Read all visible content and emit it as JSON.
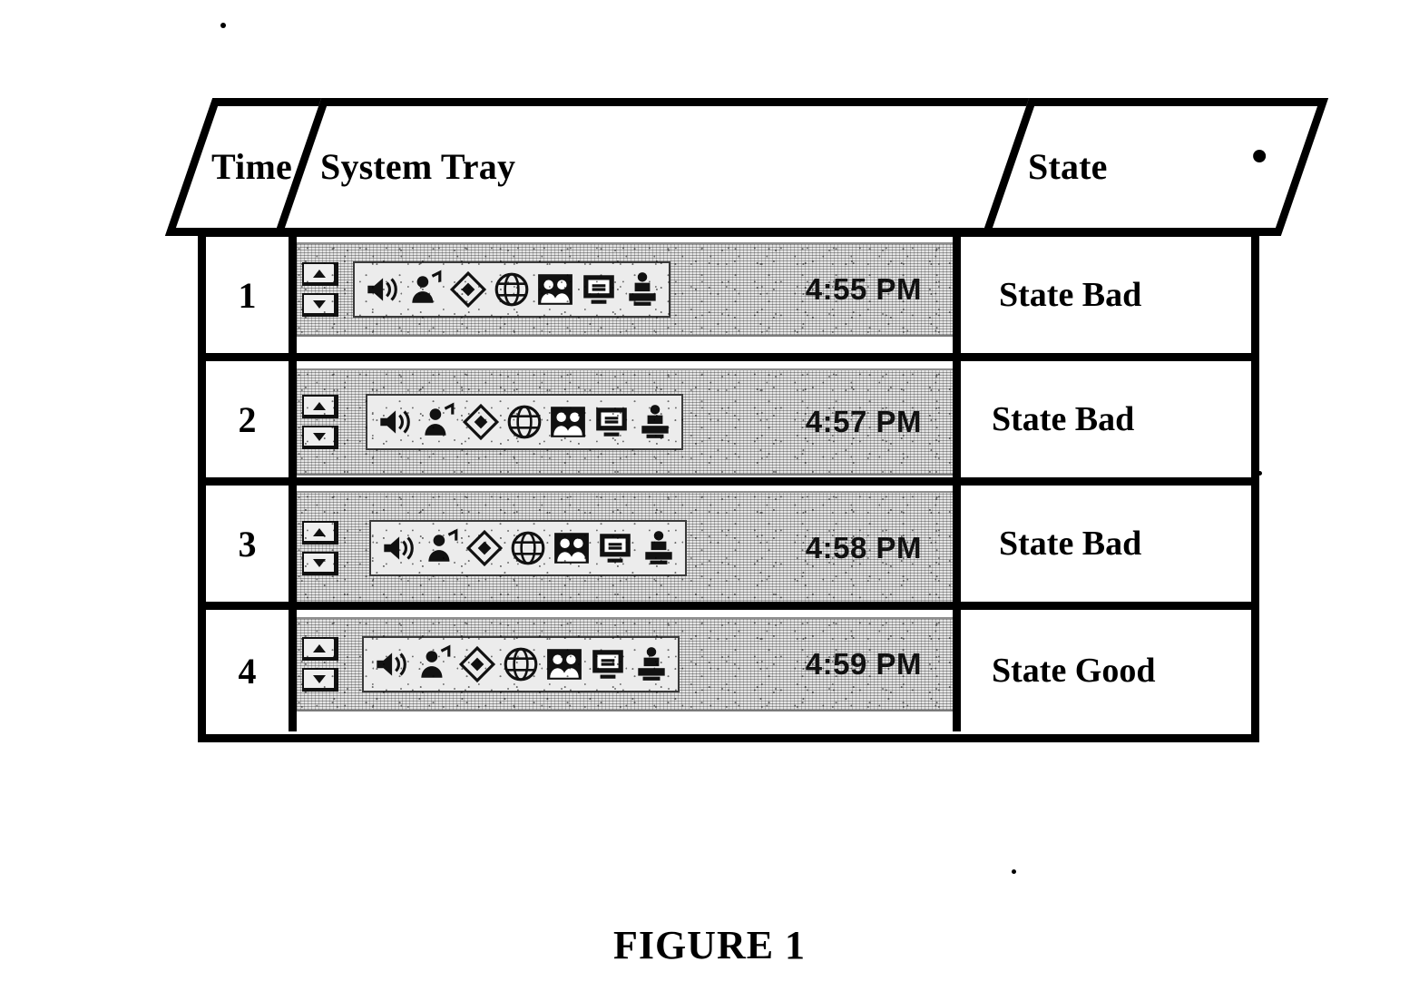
{
  "figure": {
    "caption": "FIGURE 1"
  },
  "table": {
    "headers": [
      {
        "key": "time",
        "label": "Time"
      },
      {
        "key": "tray",
        "label": "System Tray"
      },
      {
        "key": "state",
        "label": "State"
      }
    ],
    "rows": [
      {
        "time": "1",
        "state": "State Bad",
        "tray": {
          "clock": "4:55 PM",
          "icons": [
            "speaker-volume-icon",
            "person-headset-icon",
            "diamond-shield-icon",
            "globe-circle-icon",
            "two-people-icon",
            "monitor-display-icon",
            "printer-network-icon"
          ]
        }
      },
      {
        "time": "2",
        "state": "State Bad",
        "tray": {
          "clock": "4:57 PM",
          "icons": [
            "speaker-volume-icon",
            "person-headset-icon",
            "diamond-shield-icon",
            "globe-circle-icon",
            "two-people-icon",
            "monitor-display-icon",
            "printer-network-icon"
          ]
        }
      },
      {
        "time": "3",
        "state": "State Bad",
        "tray": {
          "clock": "4:58 PM",
          "icons": [
            "speaker-volume-icon",
            "person-headset-icon",
            "diamond-shield-icon",
            "globe-circle-icon",
            "two-people-icon",
            "monitor-display-icon",
            "printer-network-icon"
          ]
        }
      },
      {
        "time": "4",
        "state": "State Good",
        "tray": {
          "clock": "4:59 PM",
          "icons": [
            "speaker-volume-icon",
            "person-headset-icon",
            "diamond-shield-icon",
            "globe-circle-icon",
            "two-people-icon",
            "monitor-display-icon",
            "printer-network-icon"
          ]
        }
      }
    ]
  },
  "colors": {
    "ink": "#000000",
    "paper": "#ffffff",
    "tray_background": "#e4e4e4"
  }
}
